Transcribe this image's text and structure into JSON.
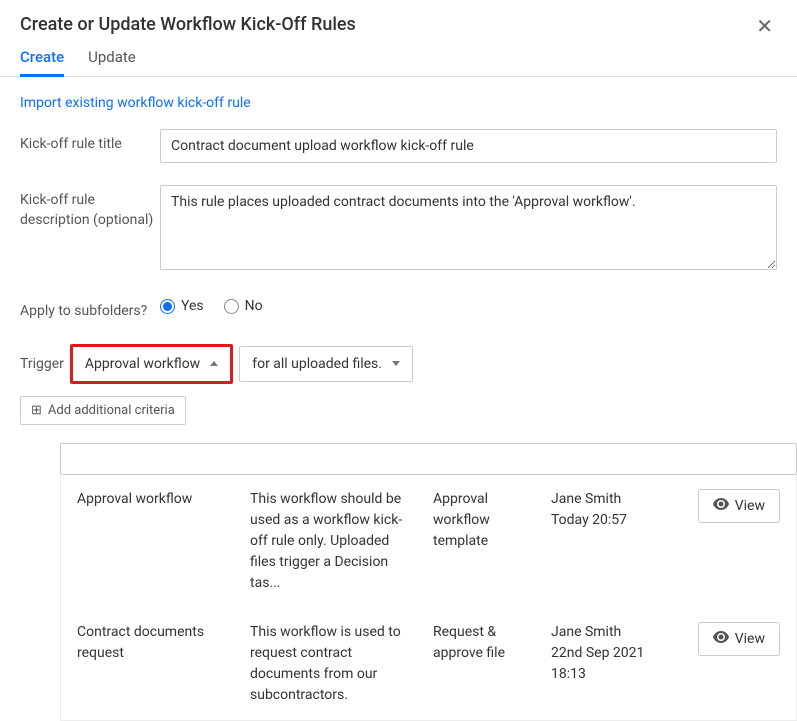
{
  "modal": {
    "title": "Create or Update Workflow Kick-Off Rules",
    "tabs": {
      "create": "Create",
      "update": "Update"
    },
    "importLink": "Import existing workflow kick-off rule",
    "labels": {
      "title": "Kick-off rule title",
      "description": "Kick-off rule description (optional)",
      "applySubfolders": "Apply to subfolders?",
      "trigger": "Trigger"
    },
    "fields": {
      "titleValue": "Contract document upload workflow kick-off rule",
      "descriptionValue": "This rule places uploaded contract documents into the 'Approval workflow'."
    },
    "radio": {
      "yes": "Yes",
      "no": "No"
    },
    "triggerDropdown": {
      "selected": "Approval workflow",
      "scopeSelected": "for all uploaded files."
    },
    "addCriteria": "Add additional criteria",
    "searchValue": "",
    "viewLabel": "View",
    "workflows": [
      {
        "name": "Approval workflow",
        "description": "This workflow should be used as a workflow kick-off rule only. Uploaded files trigger a Decision tas...",
        "template": "Approval workflow template",
        "author": "Jane Smith",
        "date": "Today 20:57"
      },
      {
        "name": "Contract documents request",
        "description": "This workflow is used to request contract documents from our subcontractors.",
        "template": "Request & approve file",
        "author": "Jane Smith",
        "date": "22nd Sep 2021 18:13"
      }
    ]
  }
}
